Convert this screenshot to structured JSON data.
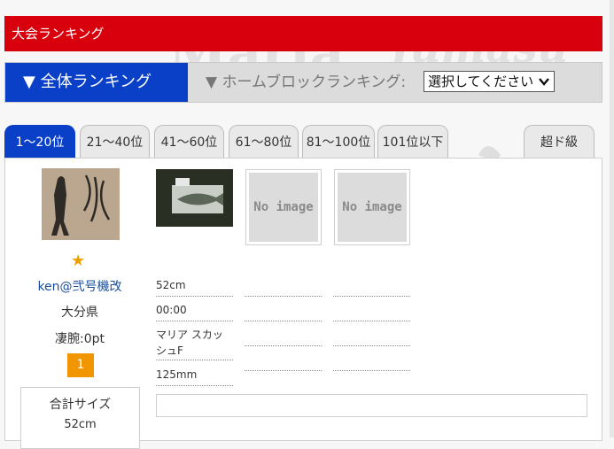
{
  "header": {
    "title": "大会ランキング"
  },
  "ranking_switch": {
    "all_label": "▼ 全体ランキング",
    "home_label": "▼ ホームブロックランキング:",
    "select_value": "選択してください"
  },
  "tabs": [
    {
      "label": "1〜20位"
    },
    {
      "label": "21〜40位"
    },
    {
      "label": "41〜60位"
    },
    {
      "label": "61〜80位"
    },
    {
      "label": "81〜100位"
    },
    {
      "label": "101位以下"
    },
    {
      "label": "超ド級"
    }
  ],
  "entry": {
    "name": "ken@弐号機改",
    "prefecture": "大分県",
    "points": "凄腕:0pt",
    "rank": "1",
    "total_label": "合計サイズ",
    "total_value": "52cm",
    "no_image_label": "No image",
    "catch": {
      "size": "52cm",
      "time": "00:00",
      "lure": "マリア スカッシュF",
      "lure_size": "125mm"
    }
  },
  "colors": {
    "brand_red": "#d9000d",
    "active_blue": "#0a3fc7",
    "badge_orange": "#f19500"
  }
}
